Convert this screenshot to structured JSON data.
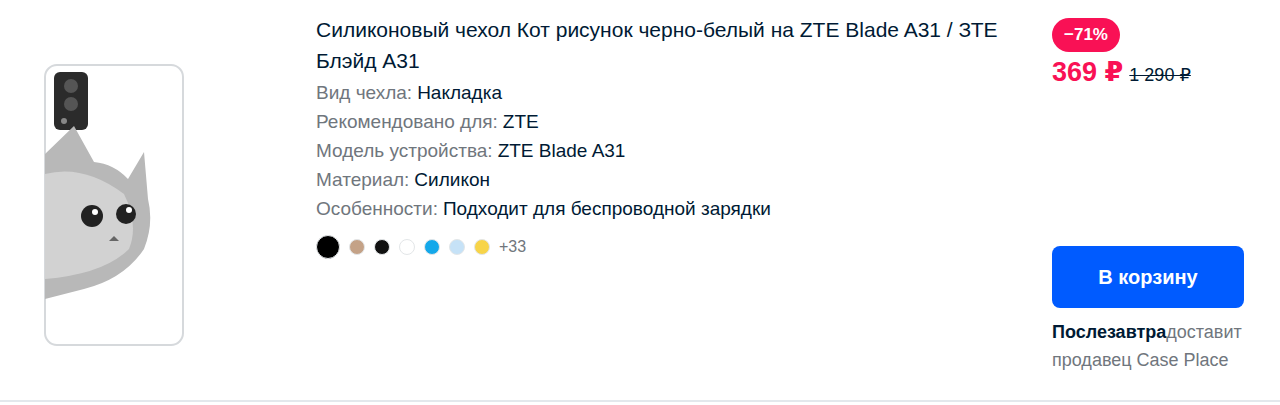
{
  "product": {
    "title": "Силиконовый чехол Кот рисунок черно-белый на ZTE Blade A31 / ЗТЕ Блэйд А31",
    "specs": [
      {
        "label": "Вид чехла:",
        "value": "Накладка"
      },
      {
        "label": "Рекомендовано для:",
        "value": "ZTE"
      },
      {
        "label": "Модель устройства:",
        "value": "ZTE Blade A31"
      },
      {
        "label": "Материал:",
        "value": "Силикон"
      },
      {
        "label": "Особенности:",
        "value": "Подходит для беспроводной зарядки"
      }
    ],
    "colors": [
      {
        "color": "#000000",
        "selected": true
      },
      {
        "color": "#c4a287",
        "selected": false
      },
      {
        "color": "#111111",
        "selected": false
      },
      {
        "color": "#ffffff",
        "selected": false
      },
      {
        "color": "#14a8ea",
        "selected": false
      },
      {
        "color": "#c6e2f7",
        "selected": false
      },
      {
        "color": "#f7d449",
        "selected": false
      }
    ],
    "more_colors": "+33"
  },
  "price": {
    "discount": "−71%",
    "current": "369 ₽",
    "old": "1 290 ₽"
  },
  "cart_button": "В корзину",
  "delivery": {
    "day": "Послезавтра",
    "text": "доставит",
    "seller": "продавец Case Place"
  }
}
